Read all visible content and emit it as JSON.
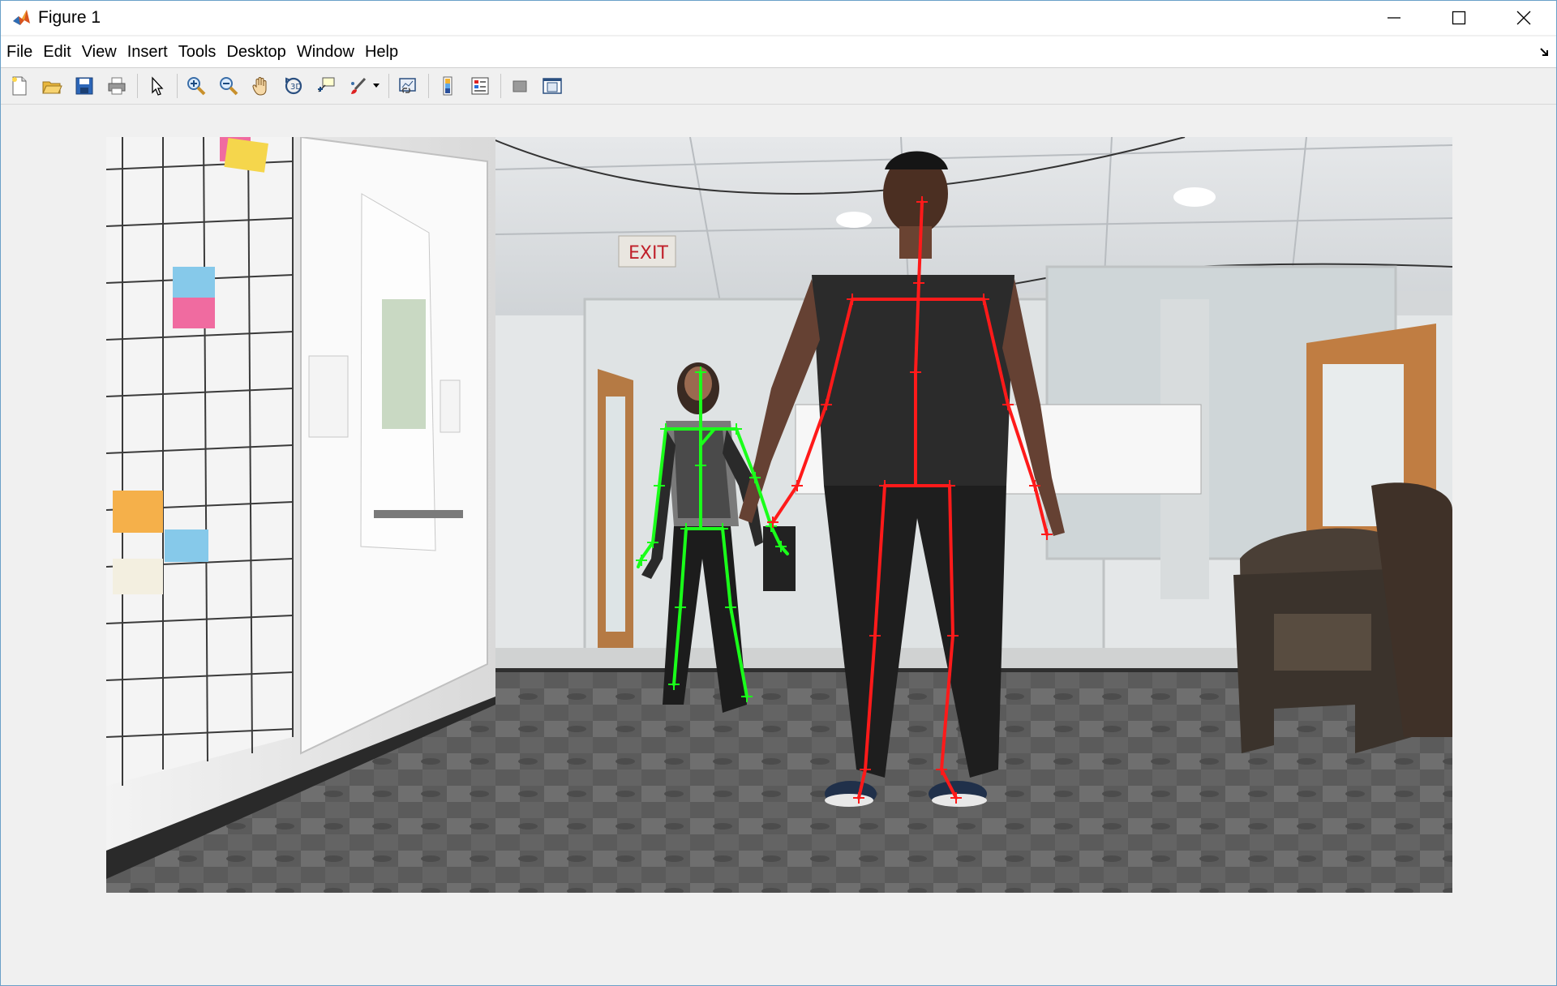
{
  "window": {
    "title": "Figure 1",
    "icon": "matlab-icon",
    "controls": [
      "minimize-icon",
      "maximize-icon",
      "close-icon"
    ]
  },
  "menu": {
    "items": [
      "File",
      "Edit",
      "View",
      "Insert",
      "Tools",
      "Desktop",
      "Window",
      "Help"
    ]
  },
  "toolbar": {
    "buttons": [
      "new-figure-icon",
      "open-file-icon",
      "save-icon",
      "print-icon",
      "edit-plot-arrow-icon",
      "zoom-in-icon",
      "zoom-out-icon",
      "pan-hand-icon",
      "rotate-3d-icon",
      "data-cursor-icon",
      "brush-icon",
      "link-plot-icon",
      "colorbar-icon",
      "legend-icon",
      "hide-plot-tools-icon",
      "show-plot-tools-icon"
    ]
  },
  "figure": {
    "content": "webcam-image-with-skeleton-overlays",
    "skeleton_colors": {
      "person_front": "#ff1a1a",
      "person_back": "#1aff1a"
    }
  }
}
